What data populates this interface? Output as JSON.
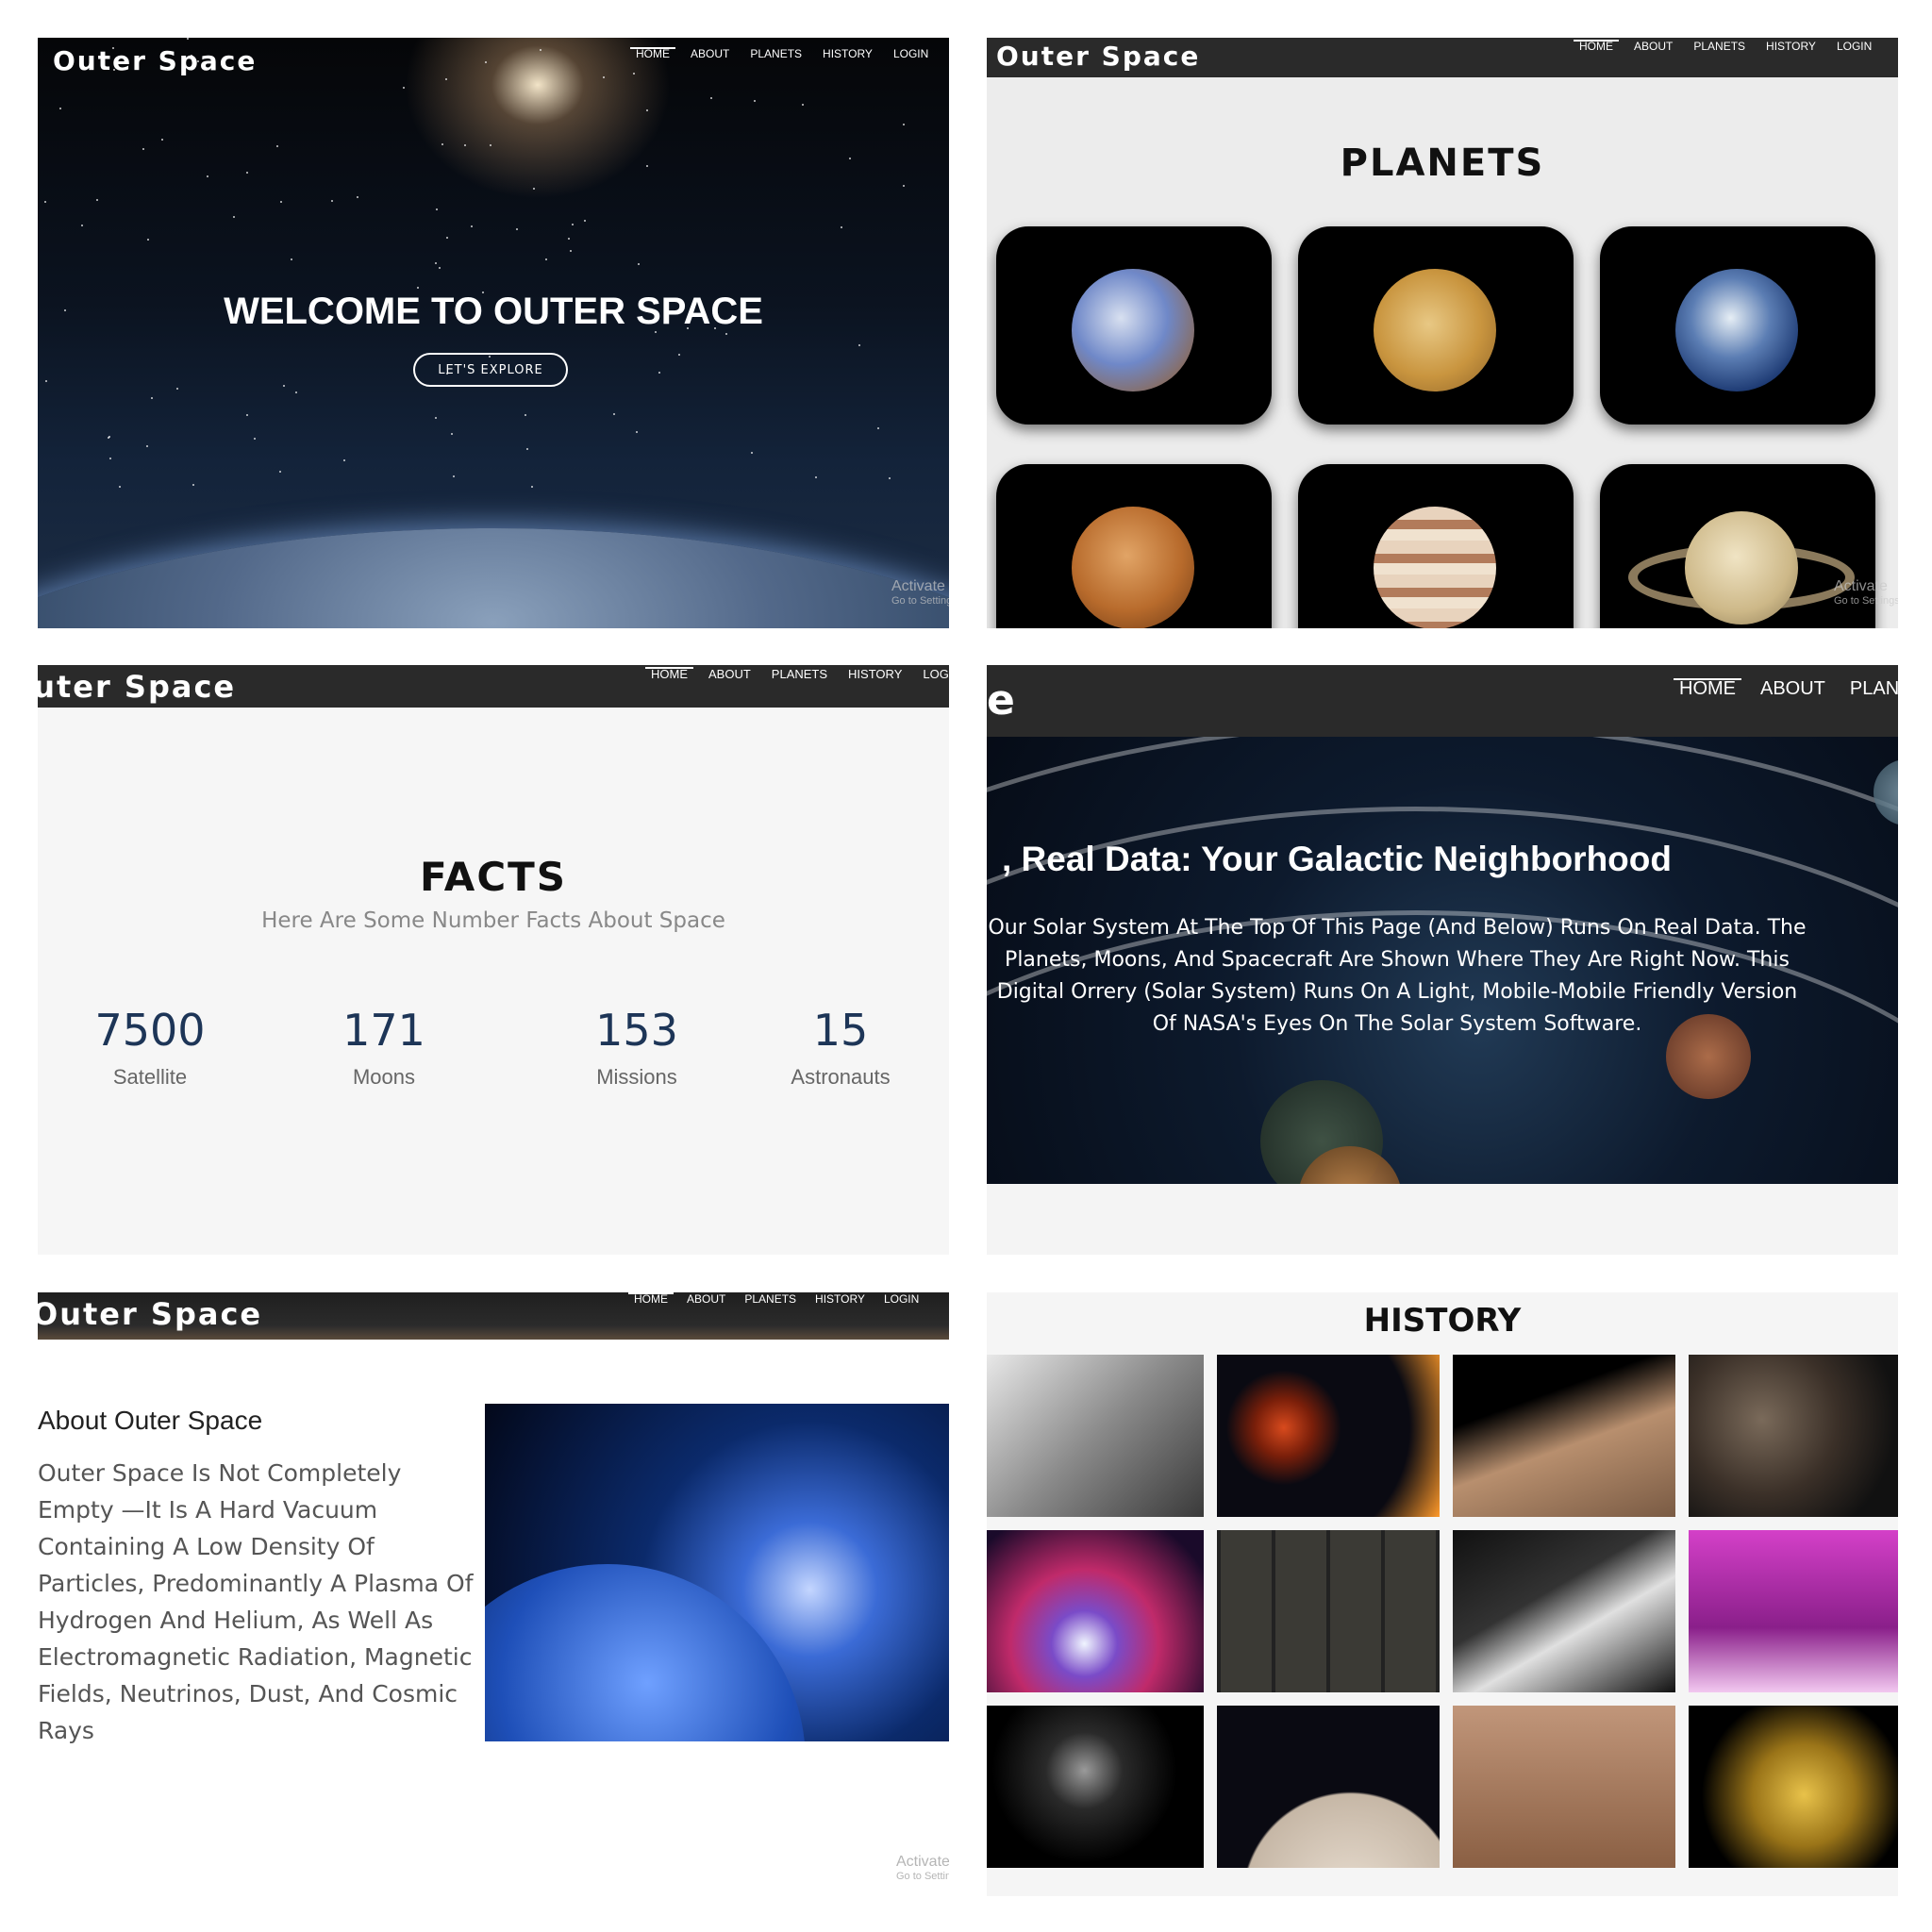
{
  "brand": "Outer Space",
  "nav": [
    "HOME",
    "ABOUT",
    "PLANETS",
    "HISTORY",
    "LOGIN"
  ],
  "watermark": {
    "title": "Activate",
    "subtitle": "Go to Settings"
  },
  "hero": {
    "title": "WELCOME TO OUTER SPACE",
    "cta": "LET'S EXPLORE"
  },
  "planets": {
    "title": "PLANETS",
    "items": [
      "mercury-icon",
      "venus-icon",
      "earth-icon",
      "mars-icon",
      "jupiter-icon",
      "saturn-icon"
    ]
  },
  "facts": {
    "title": "FACTS",
    "subtitle": "Here Are Some Number Facts About Space",
    "stats": [
      {
        "value": "7500",
        "label": "Satellite"
      },
      {
        "value": "171",
        "label": "Moons"
      },
      {
        "value": "153",
        "label": "Missions"
      },
      {
        "value": "15",
        "label": "Astronauts"
      }
    ]
  },
  "galactic": {
    "brand_fragment": "e",
    "title": ", Real Data: Your Galactic Neighborhood",
    "description": "Our Solar System At The Top Of This Page (And Below) Runs On Real Data. The Planets, Moons, And Spacecraft Are Shown Where They Are Right Now. This Digital Orrery (Solar System) Runs On A Light, Mobile-Mobile Friendly Version Of NASA's Eyes On The Solar System Software."
  },
  "about": {
    "title": "About Outer Space",
    "body": "Outer Space Is Not Completely Empty —It Is A Hard Vacuum Containing A Low Density Of Particles, Predominantly A Plasma Of Hydrogen And Helium, As Well As Electromagnetic Radiation, Magnetic Fields, Neutrinos, Dust, And Cosmic Rays"
  },
  "history": {
    "title": "HISTORY"
  }
}
